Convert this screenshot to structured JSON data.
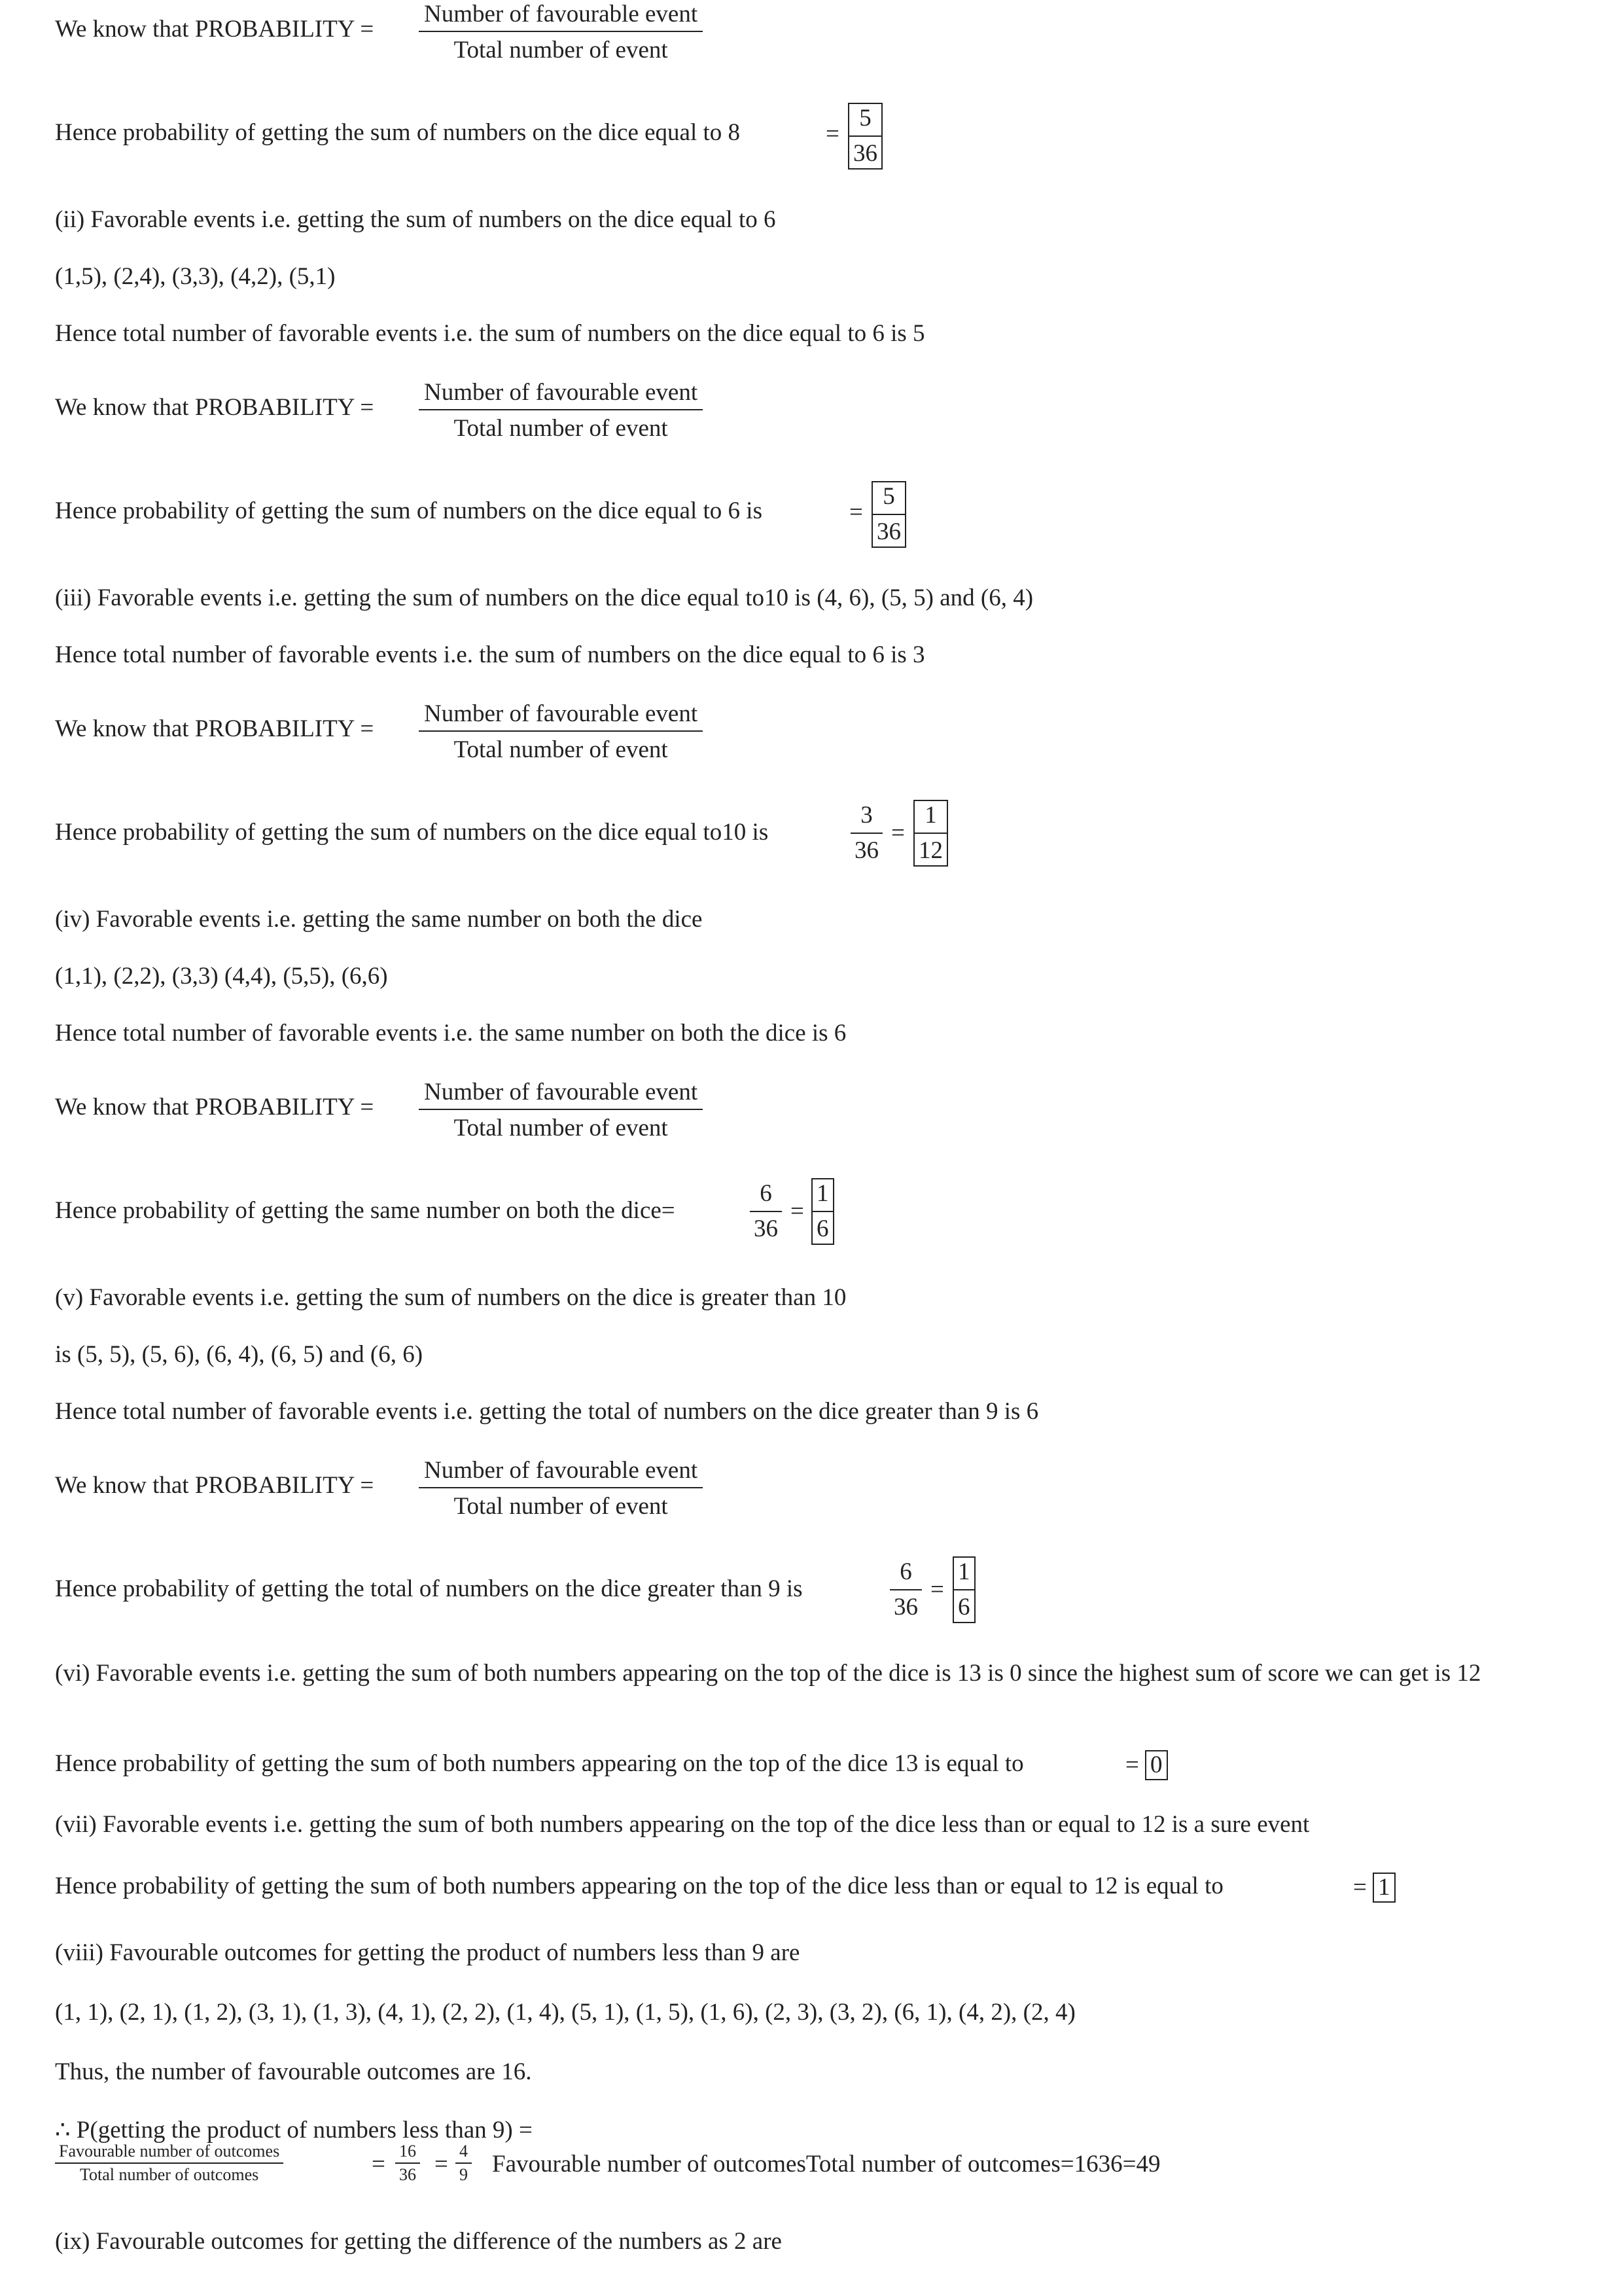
{
  "formula": {
    "prefix": "We know that PROBABILITY =",
    "numerator": "Number of favourable event",
    "denominator": "Total number of event"
  },
  "lines": {
    "l1": "Hence probability of getting the sum of numbers on the dice equal to 8",
    "l2": "(ii) Favorable events i.e. getting the sum of numbers on the dice equal to 6",
    "l3": "(1,5), (2,4), (3,3), (4,2), (5,1)",
    "l4": "Hence total number of favorable events i.e. the sum of numbers on the dice equal to 6 is 5",
    "l5": "Hence probability of getting the sum of numbers on the dice equal to 6 is",
    "l6": "(iii) Favorable events i.e. getting the sum of numbers on the dice equal to10 is (4, 6), (5, 5) and (6, 4)",
    "l7": "Hence total number of favorable events i.e. the sum of numbers on the dice equal to 6 is 3",
    "l8": "Hence probability of getting the sum of numbers on the dice equal to10 is",
    "l9": "(iv) Favorable events i.e. getting the same number on both the dice",
    "l10": "(1,1), (2,2), (3,3) (4,4), (5,5), (6,6)",
    "l11": "Hence total number of favorable events i.e. the same number on both the dice is 6",
    "l12": "Hence probability of getting the same number on both the dice=",
    "l13": "(v) Favorable events i.e. getting the sum of numbers on the dice is greater than 10",
    "l14": "is (5, 5), (5, 6), (6, 4), (6, 5) and (6, 6)",
    "l15": "Hence total number of favorable events i.e. getting the total of numbers on the dice greater than 9 is 6",
    "l16": "Hence probability of getting the total of numbers on the dice greater than 9 is",
    "l17": "(vi) Favorable events i.e. getting the sum of both numbers appearing on the top of the dice is 13 is 0 since the highest sum of score we can get is 12",
    "l18": "Hence probability of getting the sum of both numbers appearing on the top of the dice 13 is equal to",
    "l19": "(vii) Favorable events i.e. getting the sum of both numbers appearing on the top of the dice less than or equal to 12 is a sure event",
    "l20": "Hence probability of getting the sum of both numbers appearing on the top of the dice less than or equal to 12 is equal to",
    "l21": "(viii) Favourable outcomes for getting the product of numbers less than 9 are",
    "l22": "(1, 1), (2, 1), (1, 2), (3, 1), (1, 3), (4, 1), (2, 2), (1, 4), (5, 1), (1, 5), (1, 6), (2, 3), (3, 2), (6, 1), (4, 2), (2, 4)",
    "l23": "Thus, the number of favourable outcomes are 16.",
    "l24": "∴ P(getting the product of numbers less than 9) =",
    "l25": "Favourable number of outcomesTotal number of outcomes=1636=49",
    "l26": "(ix) Favourable outcomes for getting the difference of the numbers as 2 are"
  },
  "values": {
    "eq": "=",
    "v5": "5",
    "v36": "36",
    "v3": "3",
    "v1": "1",
    "v12": "12",
    "v6": "6",
    "v0": "0",
    "v16": "16",
    "v4": "4",
    "v9": "9",
    "fav_outcomes": "Favourable  number  of  outcomes",
    "tot_outcomes": "Total  number  of  outcomes"
  }
}
